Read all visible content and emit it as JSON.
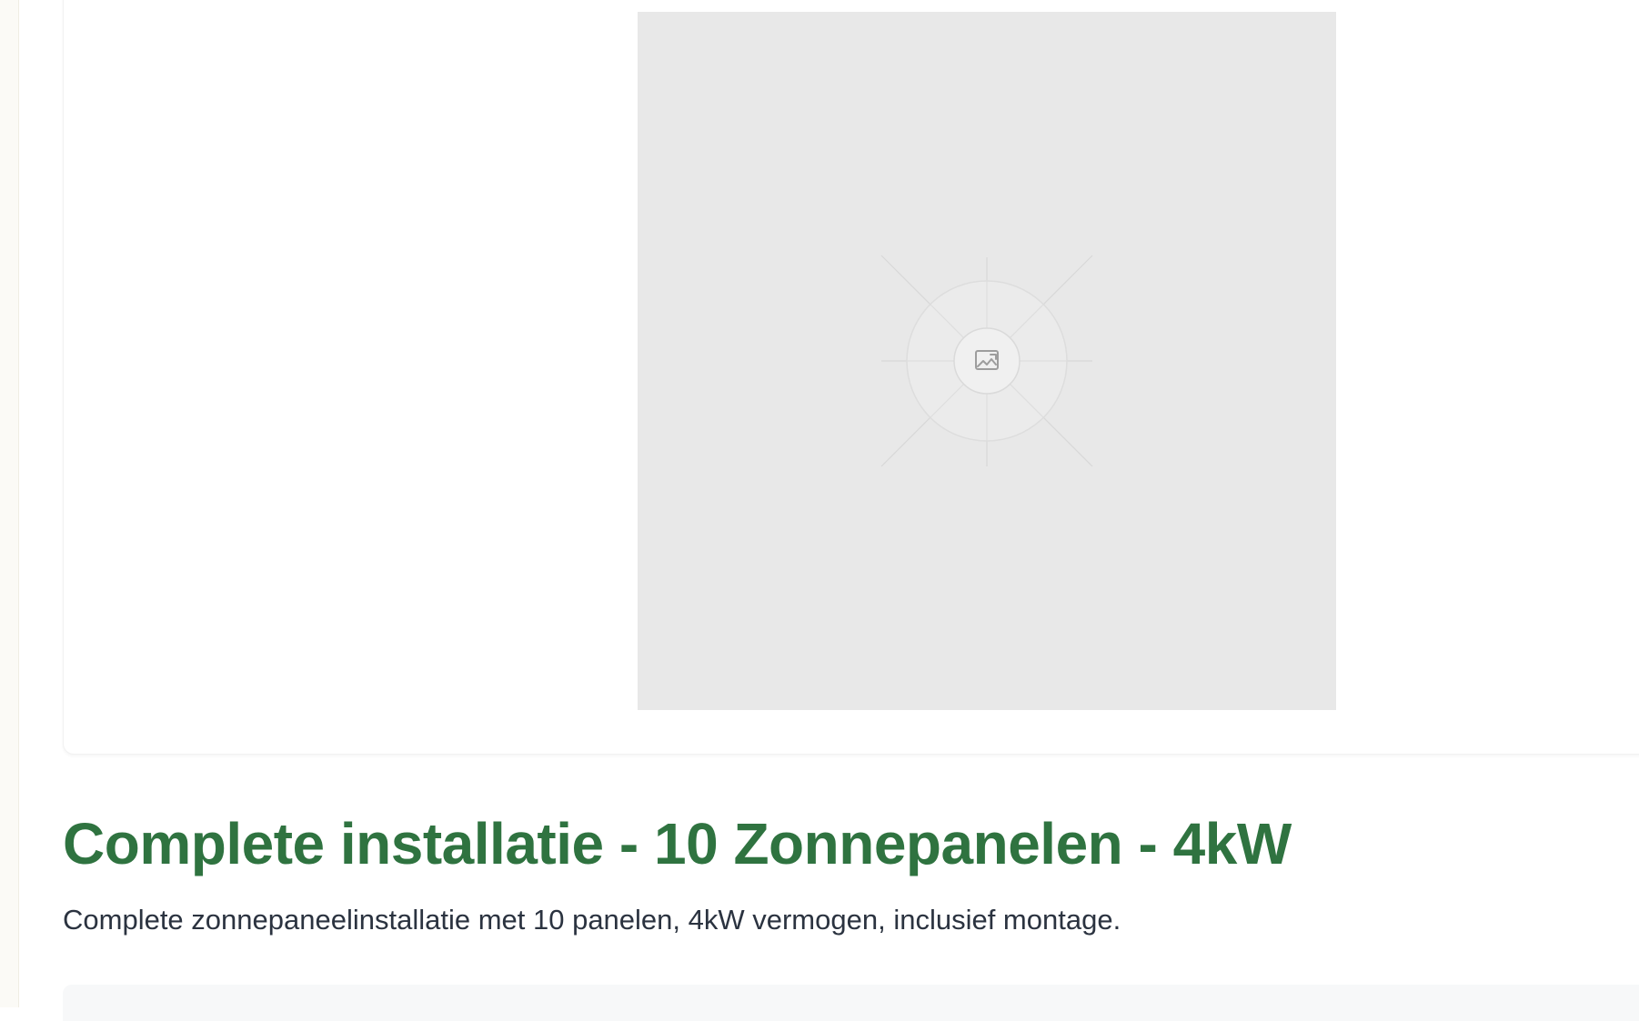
{
  "product": {
    "title": "Complete installatie - 10 Zonnepanelen - 4kW",
    "description": "Complete zonnepaneelinstallatie met 10 panelen, 4kW vermogen, inclusief montage.",
    "image": {
      "icon": "image-placeholder-icon"
    }
  },
  "colors": {
    "title": "#2f7340",
    "description": "#2b3340",
    "placeholder_bg": "#e8e8e8",
    "page_bg": "#ffffff",
    "rail_bg": "#fbfaf6"
  }
}
